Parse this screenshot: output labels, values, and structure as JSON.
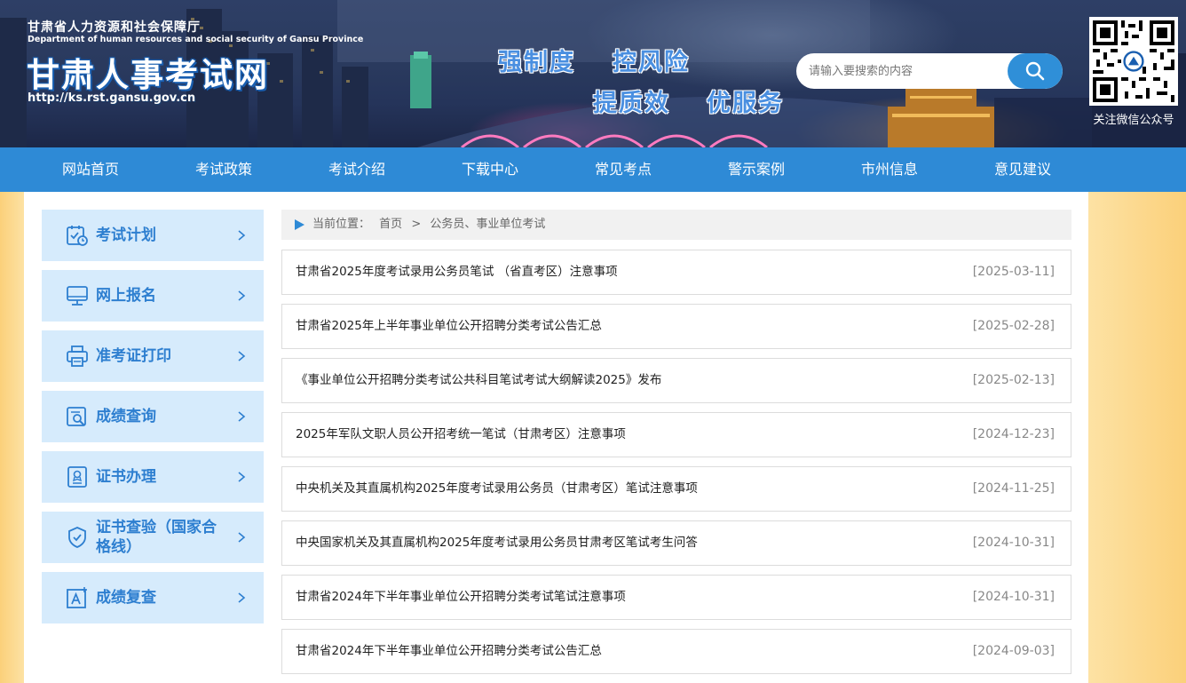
{
  "header": {
    "org_cn": "甘肃省人力资源和社会保障厅",
    "org_en": "Department of human resources and social security of Gansu Province",
    "site_title": "甘肃人事考试网",
    "site_url": "http://ks.rst.gansu.gov.cn",
    "slogans": [
      "强制度",
      "控风险",
      "提质效",
      "优服务"
    ],
    "search": {
      "placeholder": "请输入要搜索的内容",
      "icon": "search-icon"
    },
    "qr_label": "关注微信公众号"
  },
  "nav": {
    "items": [
      "网站首页",
      "考试政策",
      "考试介绍",
      "下载中心",
      "常见考点",
      "警示案例",
      "市州信息",
      "意见建议"
    ]
  },
  "sidebar": {
    "items": [
      {
        "label": "考试计划",
        "icon": "calendar-check-icon"
      },
      {
        "label": "网上报名",
        "icon": "monitor-icon"
      },
      {
        "label": "准考证打印",
        "icon": "printer-icon"
      },
      {
        "label": "成绩查询",
        "icon": "search-document-icon"
      },
      {
        "label": "证书办理",
        "icon": "certificate-icon"
      },
      {
        "label": "证书查验（国家合格线）",
        "icon": "shield-check-icon"
      },
      {
        "label": "成绩复查",
        "icon": "font-review-icon"
      }
    ]
  },
  "breadcrumb": {
    "prefix": "当前位置：",
    "home": "首页",
    "separator": ">",
    "current": "公务员、事业单位考试"
  },
  "news": [
    {
      "title": "甘肃省2025年度考试录用公务员笔试 （省直考区）注意事项",
      "date": "[2025-03-11]"
    },
    {
      "title": "甘肃省2025年上半年事业单位公开招聘分类考试公告汇总",
      "date": "[2025-02-28]"
    },
    {
      "title": "《事业单位公开招聘分类考试公共科目笔试考试大纲解读2025》发布",
      "date": "[2025-02-13]"
    },
    {
      "title": "2025年军队文职人员公开招考统一笔试（甘肃考区）注意事项",
      "date": "[2024-12-23]"
    },
    {
      "title": "中央机关及其直属机构2025年度考试录用公务员（甘肃考区）笔试注意事项",
      "date": "[2024-11-25]"
    },
    {
      "title": "中央国家机关及其直属机构2025年度考试录用公务员甘肃考区笔试考生问答",
      "date": "[2024-10-31]"
    },
    {
      "title": "甘肃省2024年下半年事业单位公开招聘分类考试笔试注意事项",
      "date": "[2024-10-31]"
    },
    {
      "title": "甘肃省2024年下半年事业单位公开招聘分类考试公告汇总",
      "date": "[2024-09-03]"
    }
  ],
  "colors": {
    "nav_bg": "#2e8ad6",
    "sidebar_bg": "#d6ebfc",
    "sidebar_text": "#2e7fd0",
    "side_gutter": "#fbd07a"
  }
}
